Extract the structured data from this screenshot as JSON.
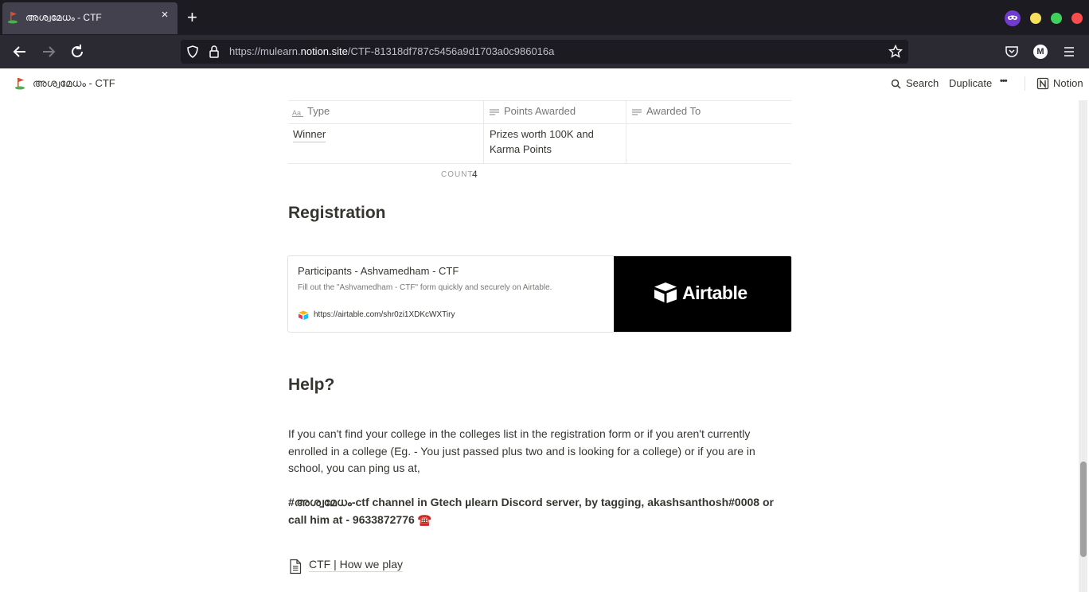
{
  "browser": {
    "tab_title": "അശ്വമേധം - CTF",
    "tab_close": "×",
    "new_tab": "+",
    "url_prefix": "https://mulearn.",
    "url_host": "notion.site",
    "url_path": "/CTF-81318df787c5456a9d1703a0c986016a",
    "profile_initial": "M",
    "window_buttons": [
      "#f6e05e",
      "#3fd15b",
      "#f94d4d"
    ]
  },
  "notion_topbar": {
    "page_title": "അശ്വമേധം - CTF",
    "search": "Search",
    "duplicate": "Duplicate",
    "more": "•••",
    "notion": "Notion"
  },
  "table": {
    "columns": [
      "Type",
      "Points Awarded",
      "Awarded To"
    ],
    "rows": [
      {
        "type": "Winner",
        "points": "Prizes worth 100K and Karma Points",
        "awarded_to": ""
      }
    ],
    "count_label": "COUNT",
    "count_value": "4"
  },
  "registration": {
    "heading": "Registration",
    "bookmark_title": "Participants - Ashvamedham - CTF",
    "bookmark_desc": "Fill out the \"Ashvamedham - CTF\" form quickly and securely on Airtable.",
    "bookmark_url": "https://airtable.com/shr0zi1XDKcWXTiry",
    "cover_text": "Airtable"
  },
  "help": {
    "heading": "Help?",
    "paragraph": "If you can't find your college in the colleges list in the registration form or if you aren't currently enrolled in a college (Eg. - You just passed plus two and is looking for a college) or if you are in school, you can ping us at,",
    "contact": "#അശ്വമേധം-ctf channel in Gtech µlearn Discord server, by tagging, akashsanthosh#0008 or call him at - 9633872776 ☎️",
    "page_link": "CTF | How we play"
  }
}
